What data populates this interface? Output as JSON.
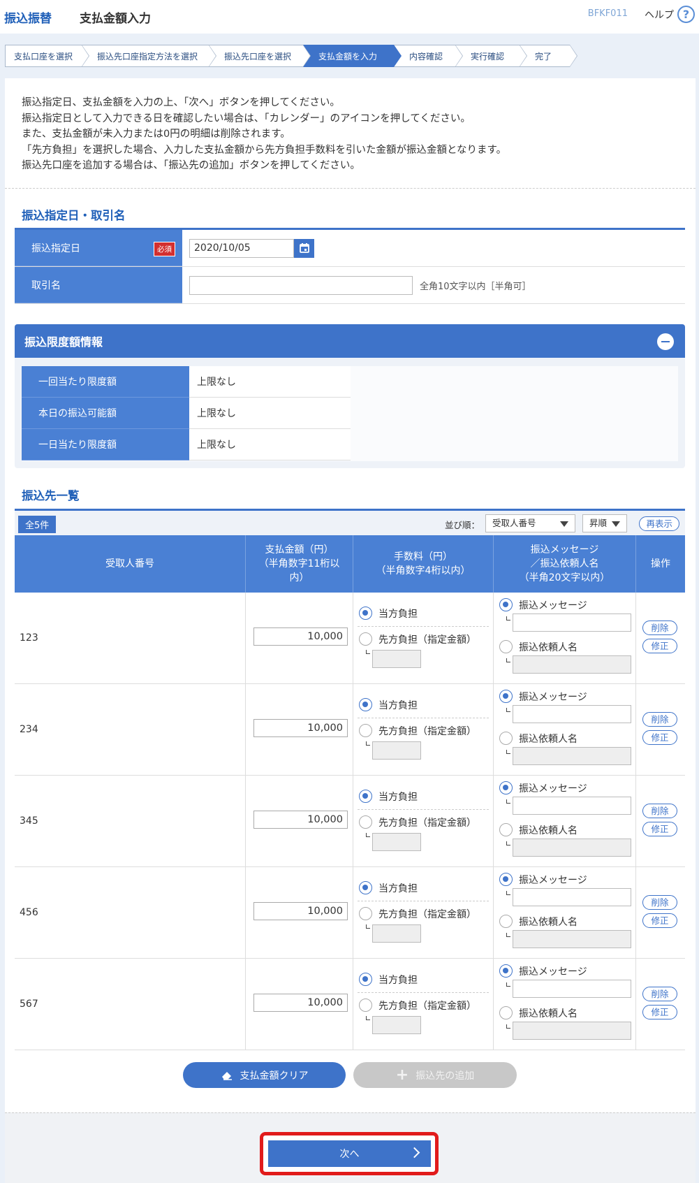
{
  "header": {
    "app_title": "振込振替",
    "page_title": "支払金額入力",
    "screen_id": "BFKF011",
    "help_label": "ヘルプ",
    "help_icon": "?"
  },
  "steps": [
    {
      "label": "支払口座を選択",
      "active": false
    },
    {
      "label": "振込先口座指定方法を選択",
      "active": false
    },
    {
      "label": "振込先口座を選択",
      "active": false
    },
    {
      "label": "支払金額を入力",
      "active": true
    },
    {
      "label": "内容確認",
      "active": false
    },
    {
      "label": "実行確認",
      "active": false
    },
    {
      "label": "完了",
      "active": false
    }
  ],
  "intro": [
    "振込指定日、支払金額を入力の上、「次へ」ボタンを押してください。",
    "振込指定日として入力できる日を確認したい場合は、「カレンダー」のアイコンを押してください。",
    "また、支払金額が未入力または0円の明細は削除されます。",
    "「先方負担」を選択した場合、入力した支払金額から先方負担手数料を引いた金額が振込金額となります。",
    "振込先口座を追加する場合は、「振込先の追加」ボタンを押してください。"
  ],
  "date_section": {
    "title": "振込指定日・取引名",
    "date_label": "振込指定日",
    "required_badge": "必須",
    "date_value": "2020/10/05",
    "name_label": "取引名",
    "name_value": "",
    "name_hint": "全角10文字以内［半角可］"
  },
  "limits": {
    "title": "振込限度額情報",
    "rows": [
      {
        "label": "一回当たり限度額",
        "value": "上限なし"
      },
      {
        "label": "本日の振込可能額",
        "value": "上限なし"
      },
      {
        "label": "一日当たり限度額",
        "value": "上限なし"
      }
    ]
  },
  "list": {
    "title": "振込先一覧",
    "count": "全5件",
    "sort_label": "並び順：",
    "sort_field": "受取人番号",
    "sort_order": "昇順",
    "redisplay": "再表示",
    "headers": {
      "recipient": "受取人番号",
      "amount": [
        "支払金額（円）",
        "（半角数字11桁以",
        "内）"
      ],
      "fee": [
        "手数料（円）",
        "（半角数字4桁以内）"
      ],
      "message": [
        "振込メッセージ",
        "／振込依頼人名",
        "（半角20文字以内）"
      ],
      "ops": "操作"
    },
    "option_labels": {
      "fee_self": "当方負担",
      "fee_payee": "先方負担（指定金額）",
      "msg": "振込メッセージ",
      "requester": "振込依頼人名",
      "delete": "削除",
      "edit": "修正"
    },
    "rows": [
      {
        "recipient": "123",
        "amount": "10,000"
      },
      {
        "recipient": "234",
        "amount": "10,000"
      },
      {
        "recipient": "345",
        "amount": "10,000"
      },
      {
        "recipient": "456",
        "amount": "10,000"
      },
      {
        "recipient": "567",
        "amount": "10,000"
      }
    ]
  },
  "buttons": {
    "clear": "支払金額クリア",
    "add": "振込先の追加",
    "next": "次へ"
  },
  "colors": {
    "primary": "#3e73c9",
    "highlight": "#e11b1b"
  }
}
